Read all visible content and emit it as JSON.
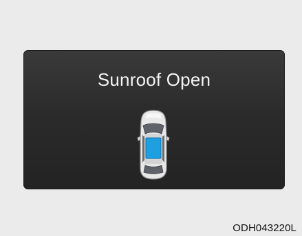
{
  "display": {
    "message": "Sunroof Open",
    "icon": "car-top-view-sunroof-open-icon",
    "sunroof_color": "#1e9fe0"
  },
  "image_code": "ODH043220L"
}
